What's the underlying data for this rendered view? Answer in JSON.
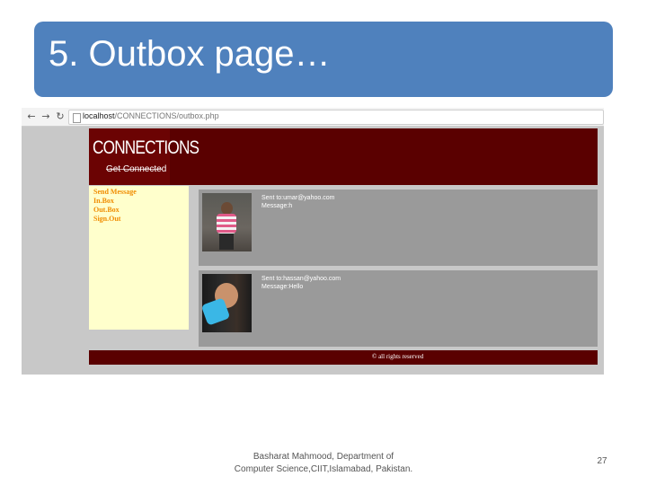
{
  "slide": {
    "title": "5. Outbox page…",
    "footer_line1": "Basharat Mahmood, Department of",
    "footer_line2": "Computer Science,CIIT,Islamabad, Pakistan.",
    "page_number": "27"
  },
  "browser": {
    "back_icon": "back-arrow-icon",
    "forward_icon": "forward-arrow-icon",
    "reload_icon": "reload-icon",
    "url_host": "localhost",
    "url_path": "/CONNECTIONS/outbox.php"
  },
  "site": {
    "logo_title": "CONNECTIONS",
    "logo_subtitle": "Get Connected",
    "header_color": "#5a0000",
    "nav": [
      "Send Message",
      "In.Box",
      "Out.Box",
      "Sign.Out"
    ],
    "nav_color": "#f08c00",
    "messages": [
      {
        "to": "Sent to:umar@yahoo.com",
        "message": "Message:h"
      },
      {
        "to": "Sent to:hassan@yahoo.com",
        "message": "Message:Hello"
      }
    ],
    "footer": "© all rights reserved"
  }
}
